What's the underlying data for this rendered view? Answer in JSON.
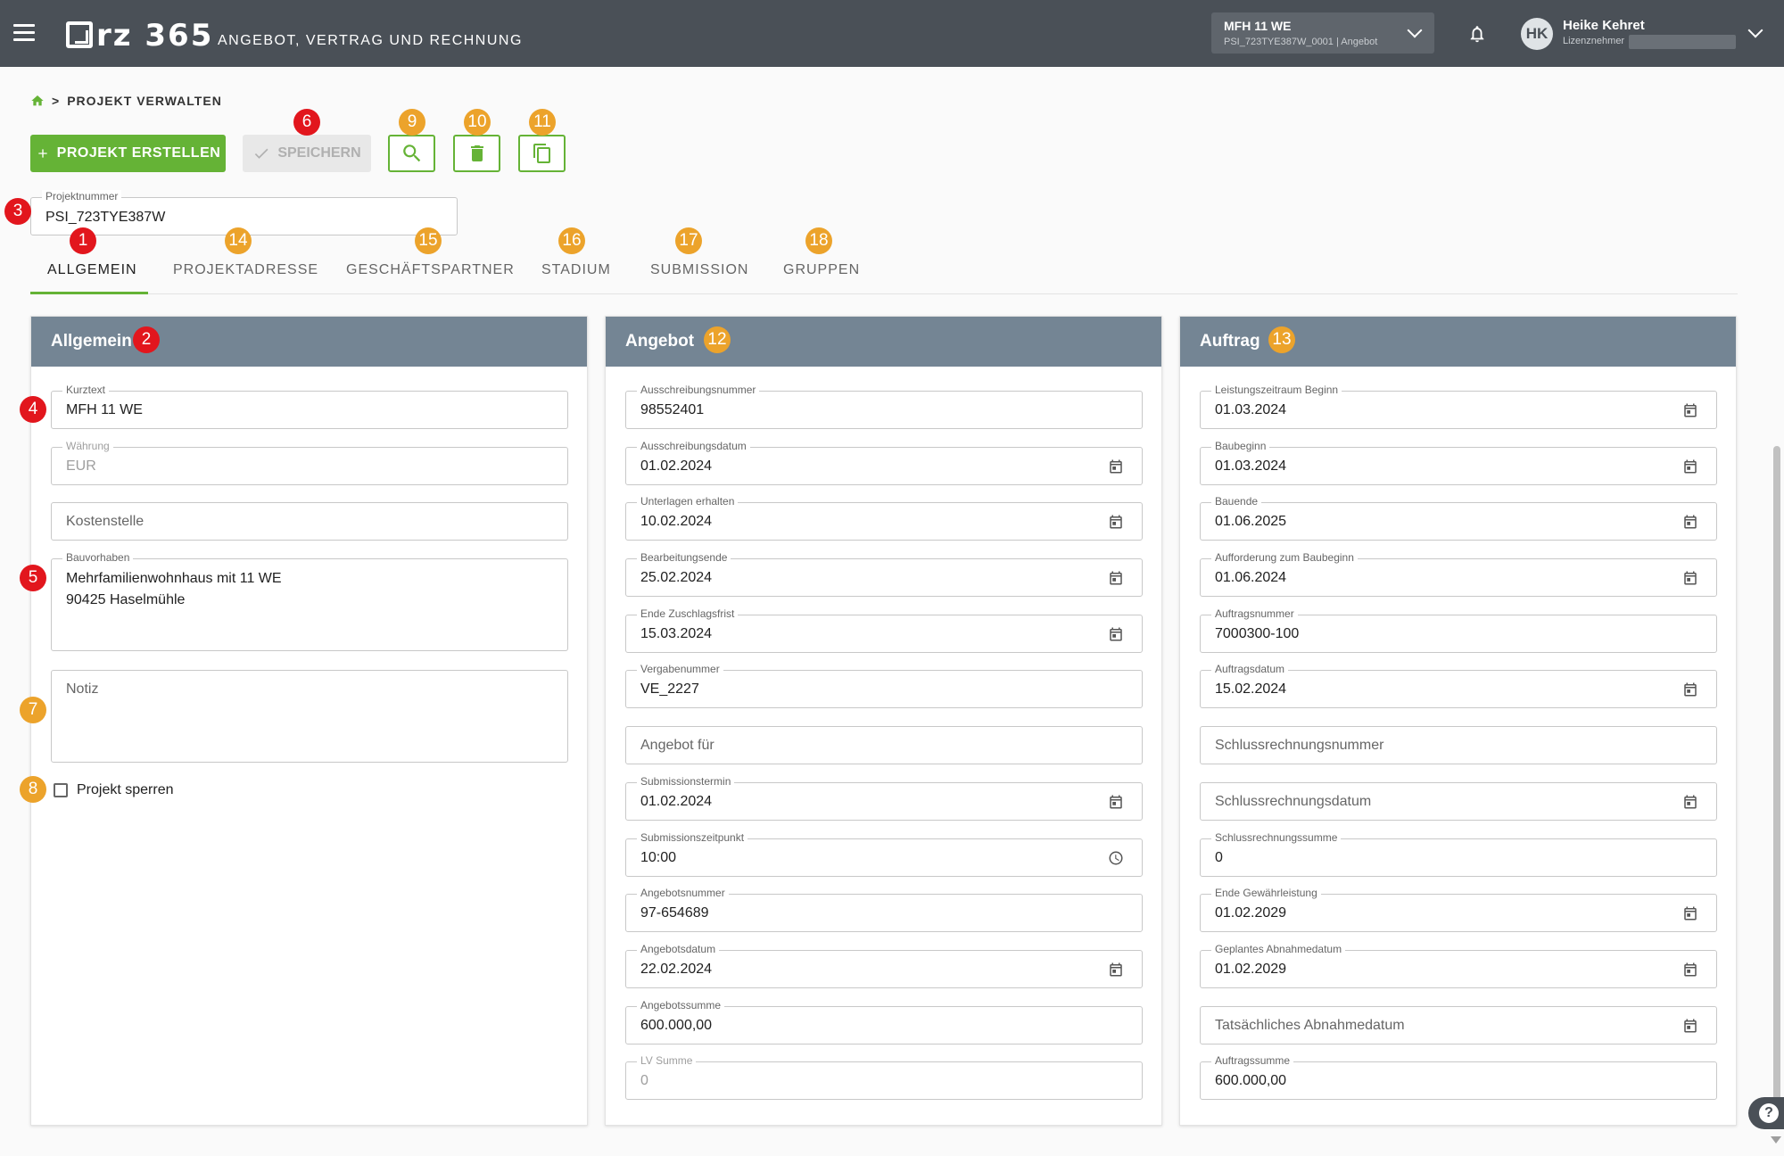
{
  "header": {
    "logo_text": "rz 365",
    "app_title": "ANGEBOT, VERTRAG UND RECHNUNG",
    "project_select": {
      "name": "MFH 11 WE",
      "sub": "PSI_723TYE387W_0001 | Angebot"
    },
    "user": {
      "initials": "HK",
      "name": "Heike Kehret",
      "role": "Lizenznehmer"
    }
  },
  "breadcrumb": {
    "label": "PROJEKT VERWALTEN"
  },
  "toolbar": {
    "create_label": "PROJEKT ERSTELLEN",
    "save_label": "SPEICHERN"
  },
  "project_number": {
    "label": "Projektnummer",
    "value": "PSI_723TYE387W"
  },
  "tabs": [
    "ALLGEMEIN",
    "PROJEKTADRESSE",
    "GESCHÄFTSPARTNER",
    "STADIUM",
    "SUBMISSION",
    "GRUPPEN"
  ],
  "badges": [
    "1",
    "2",
    "3",
    "4",
    "5",
    "6",
    "7",
    "8",
    "9",
    "10",
    "11",
    "12",
    "13",
    "14",
    "15",
    "16",
    "17",
    "18"
  ],
  "allgemein": {
    "title": "Allgemein",
    "kurztext": {
      "label": "Kurztext",
      "value": "MFH 11 WE"
    },
    "waehrung": {
      "label": "Währung",
      "value": "EUR"
    },
    "kostenstelle": {
      "placeholder": "Kostenstelle"
    },
    "bauvorhaben": {
      "label": "Bauvorhaben",
      "line1": "Mehrfamilienwohnhaus mit 11 WE",
      "line2": "90425 Haselmühle"
    },
    "notiz": {
      "placeholder": "Notiz"
    },
    "lock_label": "Projekt sperren"
  },
  "angebot": {
    "title": "Angebot",
    "ausschreibungsnummer": {
      "label": "Ausschreibungsnummer",
      "value": "98552401"
    },
    "ausschreibungsdatum": {
      "label": "Ausschreibungsdatum",
      "value": "01.02.2024"
    },
    "unterlagen_erhalten": {
      "label": "Unterlagen erhalten",
      "value": "10.02.2024"
    },
    "bearbeitungsende": {
      "label": "Bearbeitungsende",
      "value": "25.02.2024"
    },
    "ende_zuschlagsfrist": {
      "label": "Ende Zuschlagsfrist",
      "value": "15.03.2024"
    },
    "vergabenummer": {
      "label": "Vergabenummer",
      "value": "VE_2227"
    },
    "angebot_fuer": {
      "placeholder": "Angebot für"
    },
    "submissionstermin": {
      "label": "Submissionstermin",
      "value": "01.02.2024"
    },
    "submissionszeitpunkt": {
      "label": "Submissionszeitpunkt",
      "value": "10:00"
    },
    "angebotsnummer": {
      "label": "Angebotsnummer",
      "value": "97-654689"
    },
    "angebotsdatum": {
      "label": "Angebotsdatum",
      "value": "22.02.2024"
    },
    "angebotssumme": {
      "label": "Angebotssumme",
      "value": "600.000,00"
    },
    "lv_summe": {
      "label": "LV Summe",
      "value": "0"
    }
  },
  "auftrag": {
    "title": "Auftrag",
    "leistungszeitraum_beginn": {
      "label": "Leistungszeitraum Beginn",
      "value": "01.03.2024"
    },
    "baubeginn": {
      "label": "Baubeginn",
      "value": "01.03.2024"
    },
    "bauende": {
      "label": "Bauende",
      "value": "01.06.2025"
    },
    "aufforderung_baubeginn": {
      "label": "Aufforderung zum Baubeginn",
      "value": "01.06.2024"
    },
    "auftragsnummer": {
      "label": "Auftragsnummer",
      "value": "7000300-100"
    },
    "auftragsdatum": {
      "label": "Auftragsdatum",
      "value": "15.02.2024"
    },
    "schlussrechnungsnummer": {
      "placeholder": "Schlussrechnungsnummer"
    },
    "schlussrechnungsdatum": {
      "placeholder": "Schlussrechnungsdatum"
    },
    "schlussrechnungssumme": {
      "label": "Schlussrechnungssumme",
      "value": "0"
    },
    "ende_gewaehrleistung": {
      "label": "Ende Gewährleistung",
      "value": "01.02.2029"
    },
    "geplantes_abnahmedatum": {
      "label": "Geplantes Abnahmedatum",
      "value": "01.02.2029"
    },
    "tatsaechliches_abnahmedatum": {
      "placeholder": "Tatsächliches Abnahmedatum"
    },
    "auftragssumme": {
      "label": "Auftragssumme",
      "value": "600.000,00"
    }
  },
  "colors": {
    "topbar": "#4a5057",
    "accent_green": "#65b336",
    "card_header": "#748594",
    "badge_red": "#e2161d",
    "badge_orange": "#eca32b"
  },
  "icons": [
    "menu-icon",
    "bell-icon",
    "chevron-down-icon",
    "home-icon",
    "plus-icon",
    "check-icon",
    "search-icon",
    "trash-icon",
    "copy-icon",
    "calendar-icon",
    "clock-icon",
    "help-icon"
  ]
}
